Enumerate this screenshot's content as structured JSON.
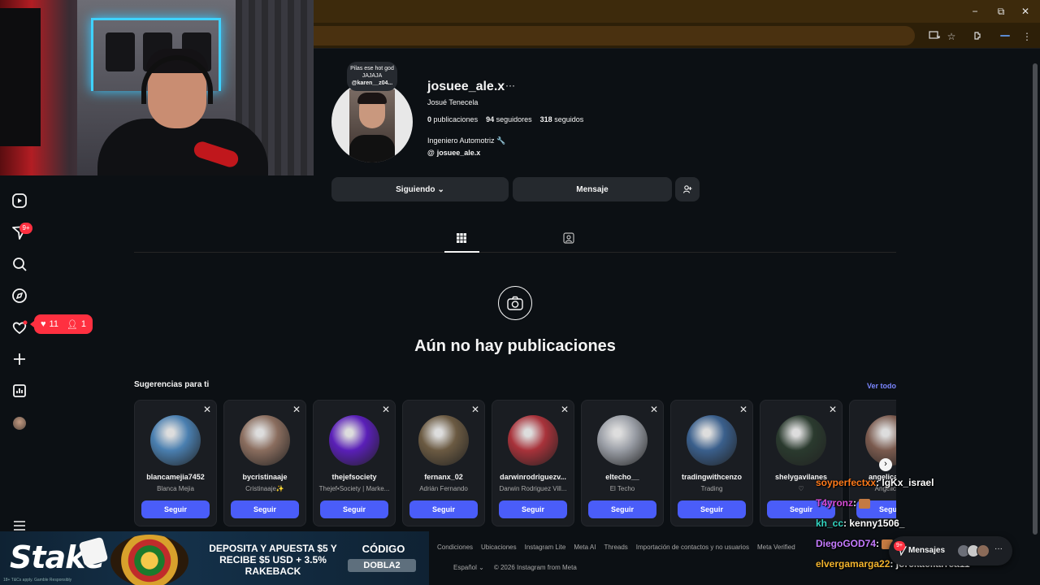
{
  "browser": {
    "window_controls": {
      "minimize": "−",
      "restore": "⧉",
      "close": "✕"
    },
    "toolbar_icons": [
      "install-icon",
      "star-icon",
      "extensions-icon",
      "menu-icon"
    ]
  },
  "nav": {
    "items": [
      "reels-icon",
      "messages-icon",
      "search-icon",
      "explore-icon",
      "notifications-icon",
      "create-icon",
      "dashboard-icon",
      "profile-avatar"
    ],
    "messages_badge": "9+",
    "notification_pill": {
      "likes": "11",
      "follows": "1"
    },
    "more_icon": "hamburger-icon"
  },
  "profile": {
    "note_line1": "Pilas ese hot god JAJAJA",
    "note_line2": "@karen__z04...",
    "username": "josuee_ale.x",
    "more": "···",
    "full_name": "Josué Tenecela",
    "posts_count": "0",
    "posts_label": "publicaciones",
    "followers_count": "94",
    "followers_label": "seguidores",
    "following_count": "318",
    "following_label": "seguidos",
    "bio": "Ingeniero Automotriz 🔧",
    "threads_handle": "josuee_ale.x",
    "following_button": "Siguiendo",
    "message_button": "Mensaje"
  },
  "tabs": [
    "posts-grid-icon",
    "tagged-icon"
  ],
  "empty_state": {
    "title": "Aún no hay publicaciones"
  },
  "suggestions": {
    "title": "Sugerencias para ti",
    "see_all": "Ver todo",
    "follow_label": "Seguir",
    "items": [
      {
        "username": "blancamejia7452",
        "name": "Blanca Mejia",
        "color": "#4a7fb0"
      },
      {
        "username": "bycristinaaje",
        "name": "Cristinaaje✨",
        "color": "#8a6d5e"
      },
      {
        "username": "thejefsociety",
        "name": "Thejef•Society | Marke...",
        "color": "#5a1fb8"
      },
      {
        "username": "fernanx_02",
        "name": "Adrián Fernando",
        "color": "#6b5a42"
      },
      {
        "username": "darwinrodriguezv...",
        "name": "Darwin Rodriguez Vill...",
        "color": "#a8323a"
      },
      {
        "username": "eltecho__",
        "name": "El Techo",
        "color": "#9a9ea6"
      },
      {
        "username": "tradingwithcenzo",
        "name": "Trading",
        "color": "#3a5f8c"
      },
      {
        "username": "shelygavilanes",
        "name": "♡",
        "color": "#2a3a2e"
      },
      {
        "username": "angelica_d...",
        "name": "Angelica D",
        "color": "#7a5a4e"
      }
    ]
  },
  "footer": {
    "links": [
      "Condiciones",
      "Ubicaciones",
      "Instagram Lite",
      "Meta AI",
      "Threads",
      "Importación de contactos y no usuarios",
      "Meta Verified"
    ],
    "language": "Español",
    "copyright": "© 2026 Instagram from Meta"
  },
  "stake": {
    "logo": "Stake",
    "small_print": "18+ T&Cs apply. Gamble Responsibly",
    "offer": "DEPOSITA Y APUESTA $5 Y RECIBE $5 USD + 3.5% RAKEBACK",
    "code_label": "CÓDIGO",
    "code": "DOBLA2"
  },
  "chat": [
    {
      "nick": "soyperfectxx",
      "color": "#ff7a1a",
      "msg": "lgKx_israel"
    },
    {
      "nick": "T4yronz",
      "color": "#d84dd8",
      "msg": ""
    },
    {
      "nick": "kh_cc",
      "color": "#33d6c2",
      "msg": "kenny1506_"
    },
    {
      "nick": "DiegoGOD74",
      "color": "#c57bff",
      "msg": ""
    },
    {
      "nick": "elvergamarga22",
      "color": "#f2b42e",
      "msg": "jorckaellarrea11"
    }
  ],
  "messages_pill": {
    "label": "Mensajes",
    "badge": "9+",
    "more": "···"
  }
}
